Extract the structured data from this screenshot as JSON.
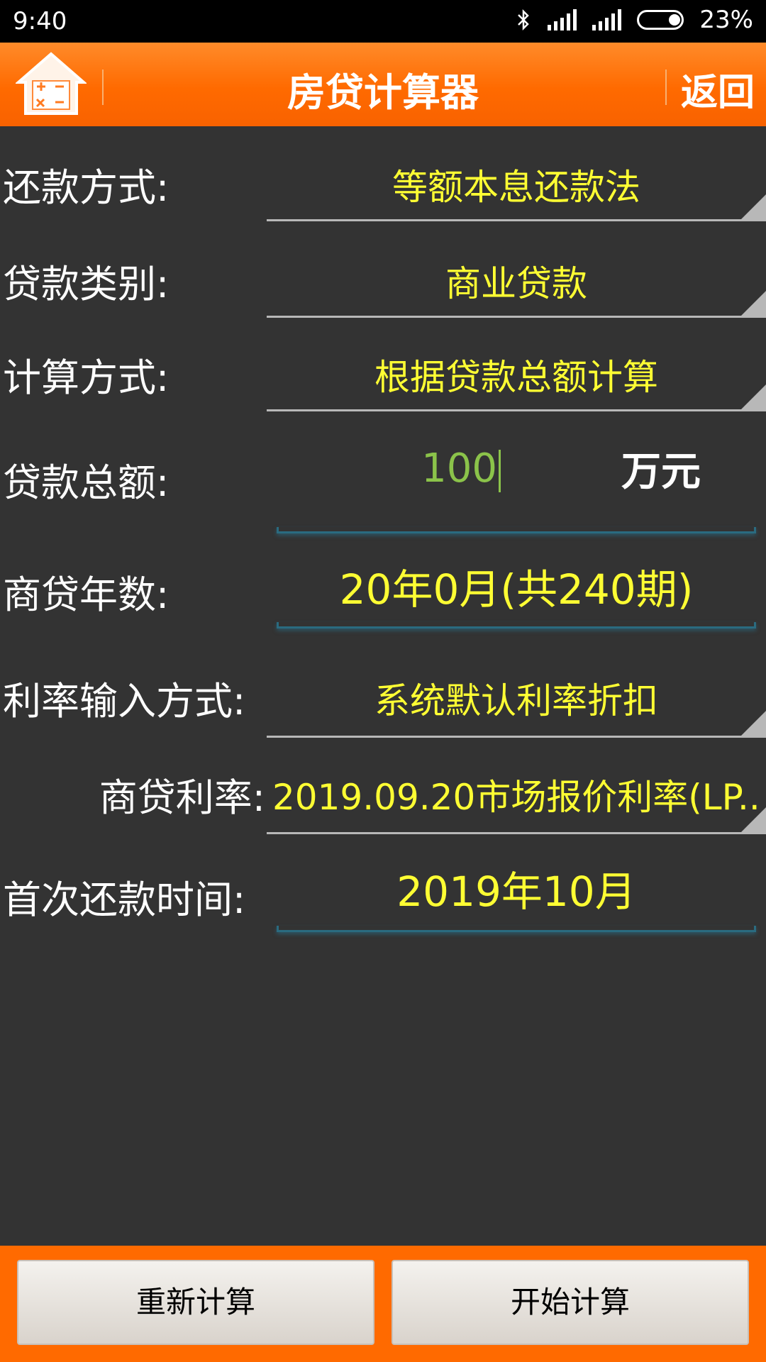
{
  "status": {
    "time": "9:40",
    "battery": "23%"
  },
  "header": {
    "title": "房贷计算器",
    "back_label": "返回"
  },
  "form": {
    "repayment_method": {
      "label": "还款方式:",
      "value": "等额本息还款法"
    },
    "loan_type": {
      "label": "贷款类别:",
      "value": "商业贷款"
    },
    "calc_method": {
      "label": "计算方式:",
      "value": "根据贷款总额计算"
    },
    "loan_amount": {
      "label": "贷款总额:",
      "value": "100",
      "unit": "万元"
    },
    "loan_years": {
      "label": "商贷年数:",
      "value": "20年0月(共240期)"
    },
    "rate_input_method": {
      "label": "利率输入方式:",
      "value": "系统默认利率折扣"
    },
    "commercial_rate": {
      "label": "商贷利率:",
      "value": "2019.09.20市场报价利率(LP.."
    },
    "first_payment": {
      "label": "首次还款时间:",
      "value": "2019年10月"
    }
  },
  "buttons": {
    "reset": "重新计算",
    "calculate": "开始计算"
  },
  "colors": {
    "accent": "#ff6a00",
    "value_text": "#ffff33",
    "input_text": "#8bc34a",
    "background": "#333333"
  }
}
